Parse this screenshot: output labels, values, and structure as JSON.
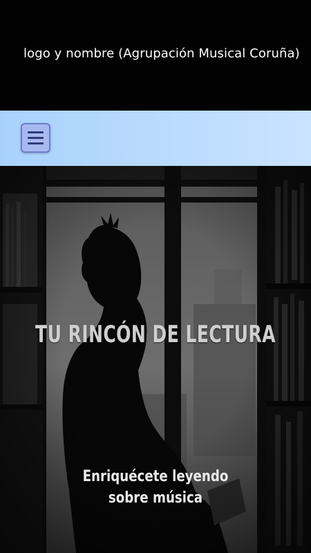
{
  "header": {
    "brand_text": "logo y nombre (Agrupación Musical Coruña)"
  },
  "nav": {
    "menu_icon": "hamburger-icon"
  },
  "hero": {
    "title": "TU RINCÓN DE LECTURA",
    "subtitle_line1": "Enriquécete leyendo",
    "subtitle_line2": "sobre música"
  }
}
